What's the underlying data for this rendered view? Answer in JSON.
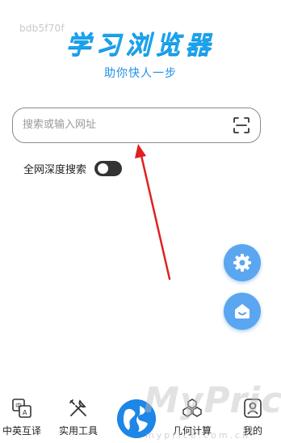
{
  "overlay_text": "bdb5f70f",
  "header": {
    "title": "学习浏览器",
    "subtitle": "助你快人一步"
  },
  "search": {
    "placeholder": "搜索或输入网址",
    "value": ""
  },
  "deep_search": {
    "label": "全网深度搜索",
    "enabled": false
  },
  "fabs": [
    {
      "icon": "settings-gear-icon"
    },
    {
      "icon": "home-face-icon"
    }
  ],
  "tabbar": {
    "items": [
      {
        "label": "中英互译",
        "icon": "translate-icon"
      },
      {
        "label": "实用工具",
        "icon": "tools-icon"
      },
      {
        "label": "",
        "icon": "globe-icon"
      },
      {
        "label": "几何计算",
        "icon": "geometry-cubes-icon"
      },
      {
        "label": "我的",
        "icon": "profile-icon"
      }
    ]
  },
  "watermark": {
    "brand": "MyPrice",
    "domain": "myprice.com.cn"
  },
  "colors": {
    "title_blue": "#1aa3ee",
    "subtitle_blue": "#1e90e6",
    "fab_blue": "#5aa6f0",
    "globe_blue": "#1d86e6",
    "arrow_red": "#e02020",
    "toggle_off": "#333333"
  }
}
